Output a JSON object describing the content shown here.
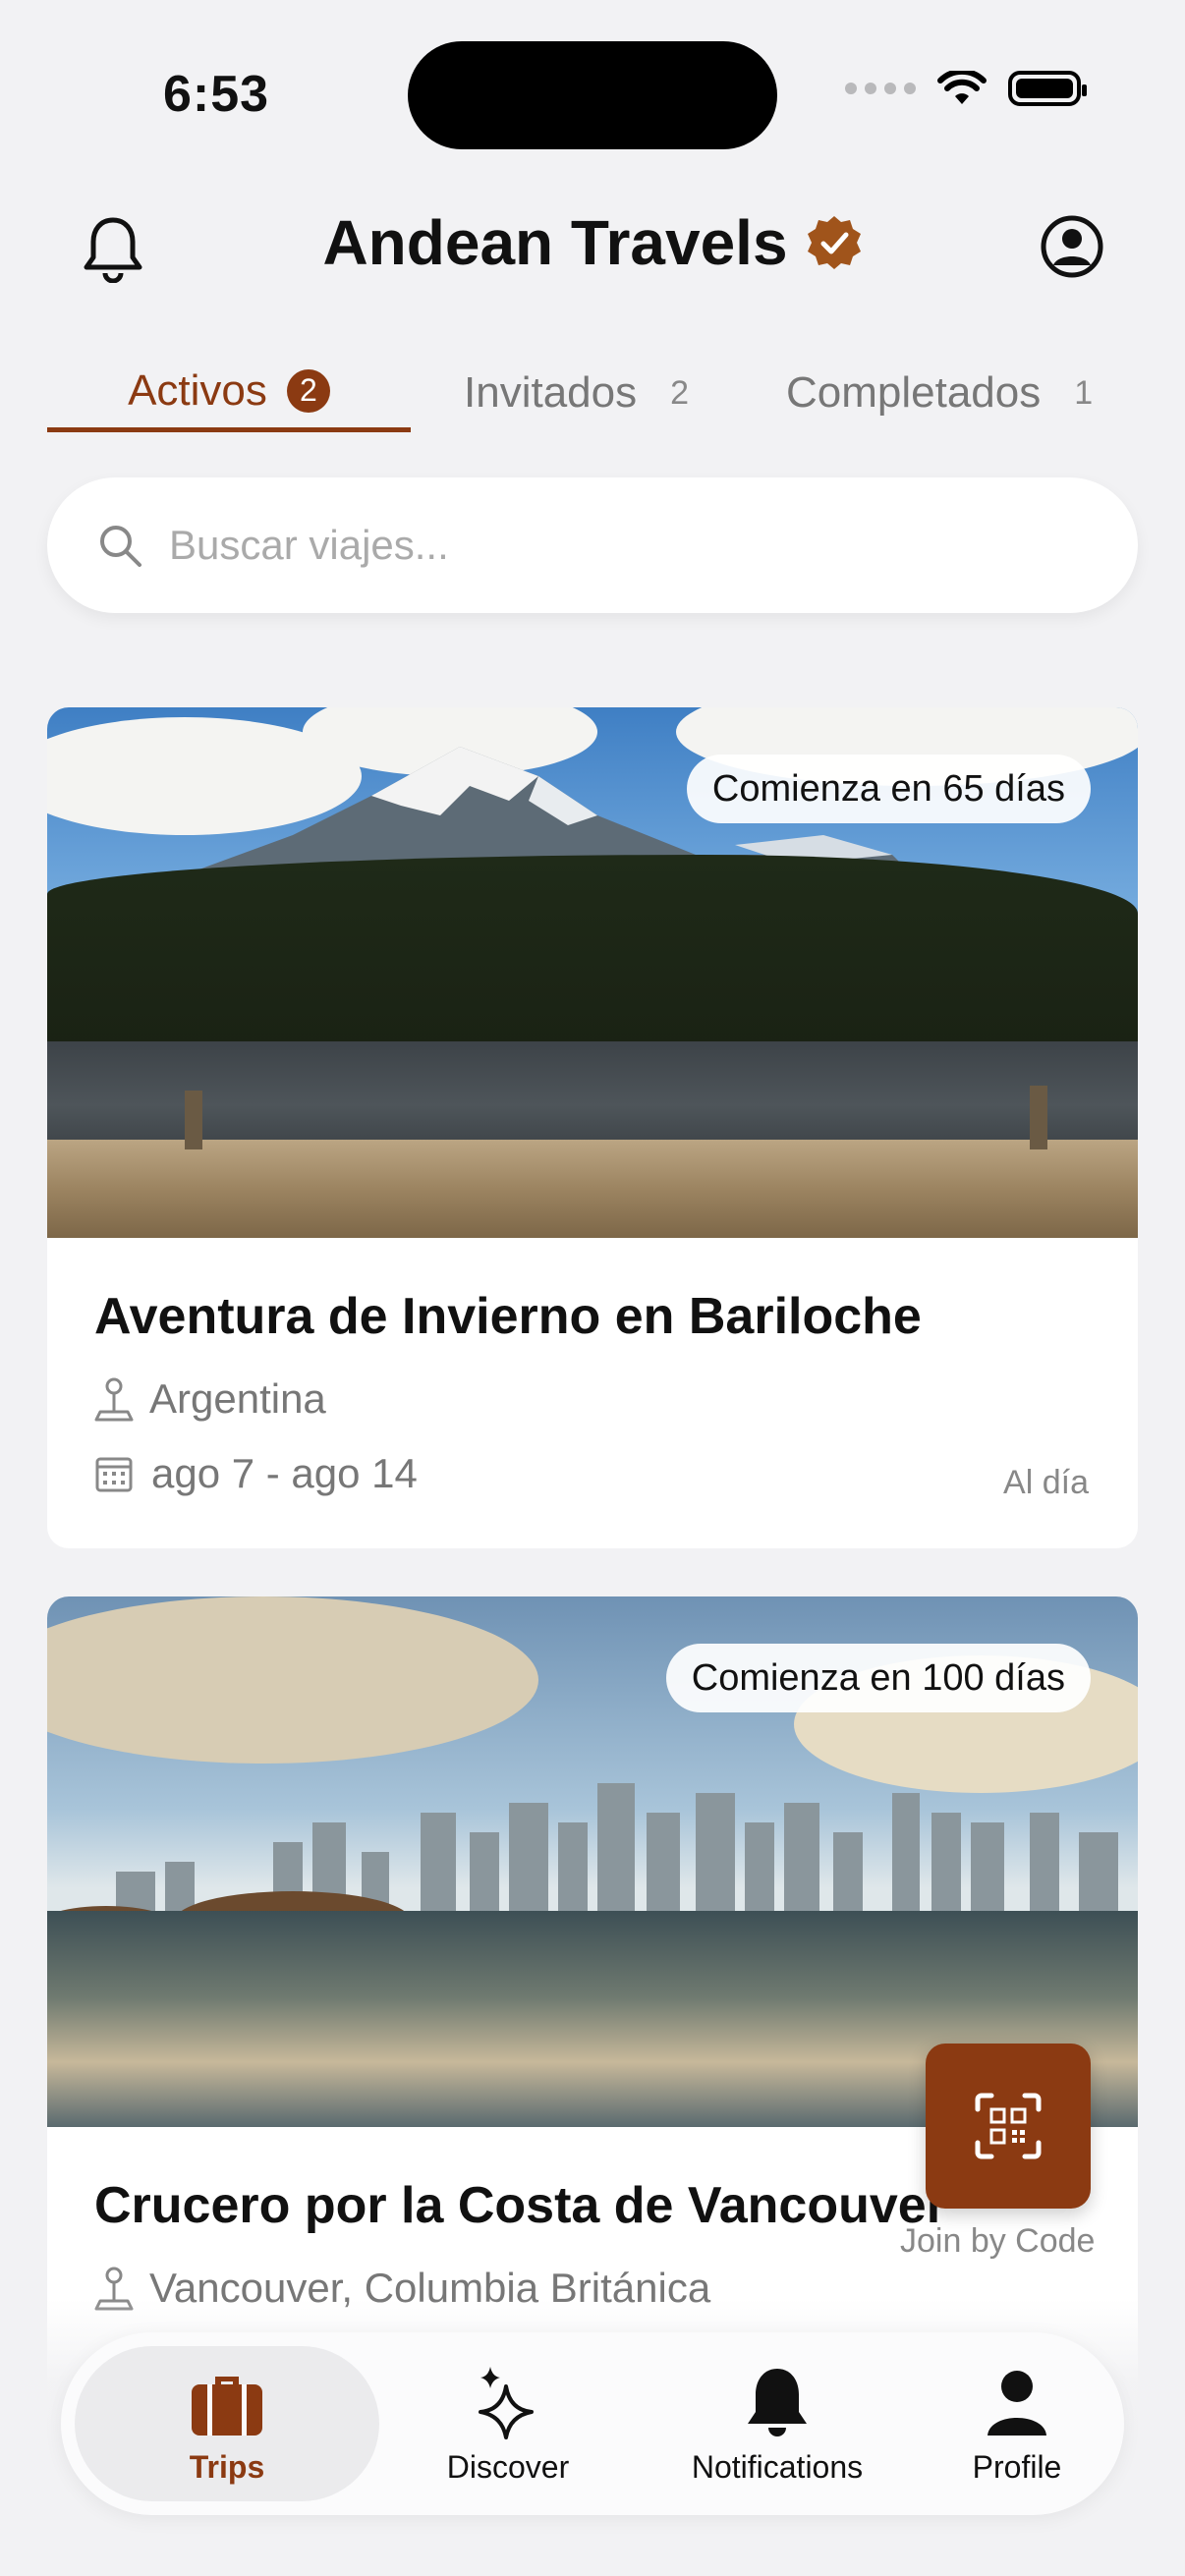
{
  "status_bar": {
    "time": "6:53"
  },
  "header": {
    "title": "Andean Travels"
  },
  "tabs": [
    {
      "label": "Activos",
      "count": "2"
    },
    {
      "label": "Invitados",
      "count": "2"
    },
    {
      "label": "Completados",
      "count": "1"
    }
  ],
  "search": {
    "placeholder": "Buscar viajes..."
  },
  "trips": [
    {
      "badge": "Comienza en 65 días",
      "title": "Aventura de Invierno en Bariloche",
      "location": "Argentina",
      "dates": "ago 7 - ago 14",
      "status": "Al día"
    },
    {
      "badge": "Comienza en 100 días",
      "title": "Crucero por la Costa de Vancouver",
      "location": "Vancouver, Columbia Británica"
    }
  ],
  "fab": {
    "label": "Join by Code"
  },
  "bottom_nav": [
    {
      "label": "Trips",
      "icon": "suitcase-icon"
    },
    {
      "label": "Discover",
      "icon": "sparkles-icon"
    },
    {
      "label": "Notifications",
      "icon": "bell-icon"
    },
    {
      "label": "Profile",
      "icon": "person-icon"
    }
  ],
  "colors": {
    "accent": "#8b3a12",
    "background": "#f2f2f4"
  }
}
